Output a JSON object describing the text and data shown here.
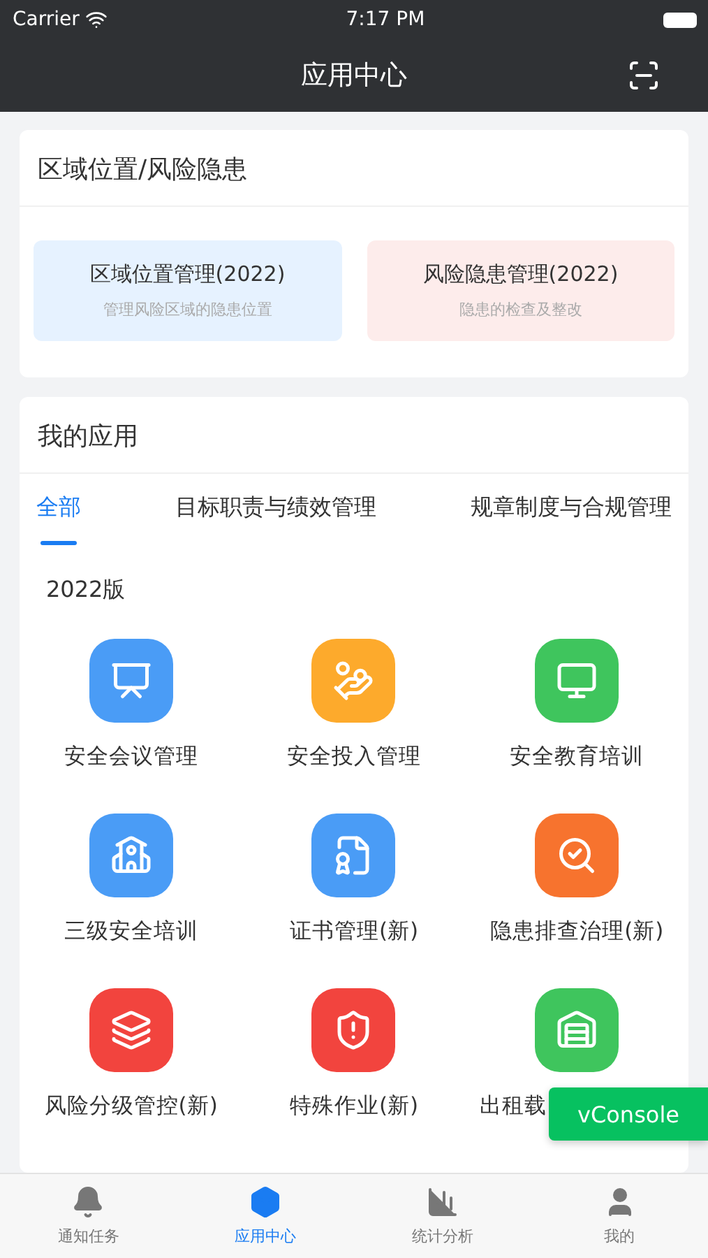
{
  "status_bar": {
    "carrier": "Carrier",
    "time": "7:17 PM"
  },
  "nav": {
    "title": "应用中心"
  },
  "featured": {
    "title": "区域位置/风险隐患",
    "cards": [
      {
        "title": "区域位置管理(2022)",
        "subtitle": "管理风险区域的隐患位置",
        "color": "#e6f2ff"
      },
      {
        "title": "风险隐患管理(2022)",
        "subtitle": "隐患的检查及整改",
        "color": "#fdeceb"
      }
    ]
  },
  "my_apps": {
    "title": "我的应用",
    "tabs": [
      {
        "label": "全部",
        "selected": true
      },
      {
        "label": "目标职责与绩效管理",
        "selected": false
      },
      {
        "label": "规章制度与合规管理",
        "selected": false
      }
    ],
    "section": "2022版",
    "apps": [
      {
        "label": "安全会议管理",
        "color": "#4a9cf6",
        "covered": false
      },
      {
        "label": "安全投入管理",
        "color": "#fdaa2c",
        "covered": false
      },
      {
        "label": "安全教育培训",
        "color": "#3fc55d",
        "covered": false
      },
      {
        "label": "三级安全培训",
        "color": "#4a9cf6",
        "covered": false
      },
      {
        "label": "证书管理(新)",
        "color": "#4a9cf6",
        "covered": false
      },
      {
        "label": "隐患排查治理(新)",
        "color": "#f7732e",
        "covered": false
      },
      {
        "label": "风险分级管控(新)",
        "color": "#f2443e",
        "covered": false
      },
      {
        "label": "特殊作业(新)",
        "color": "#f2443e",
        "covered": false
      },
      {
        "label": "出租载",
        "color": "#3fc55d",
        "covered": true
      }
    ]
  },
  "floating_button": "vConsole",
  "tab_bar": [
    {
      "label": "通知任务",
      "selected": false
    },
    {
      "label": "应用中心",
      "selected": true
    },
    {
      "label": "统计分析",
      "selected": false
    },
    {
      "label": "我的",
      "selected": false
    }
  ]
}
